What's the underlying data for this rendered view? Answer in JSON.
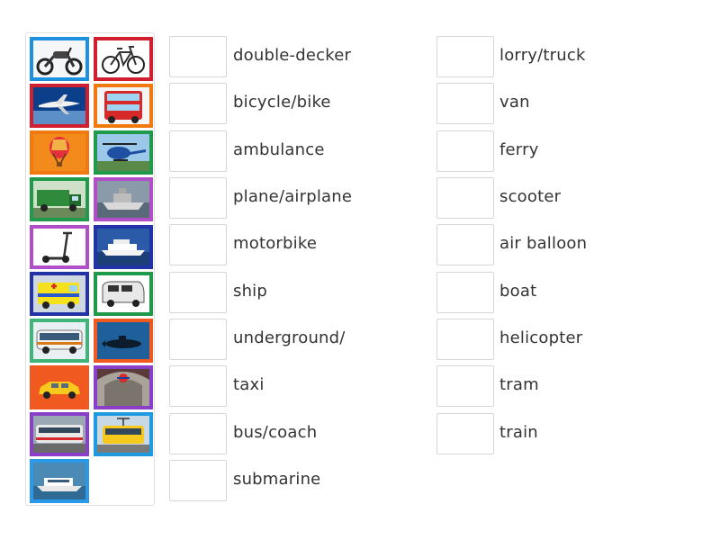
{
  "tiles": [
    {
      "name": "motorbike-picture",
      "border": "#1e90e0",
      "icon": "motorbike"
    },
    {
      "name": "bicycle-picture",
      "border": "#d11f2f",
      "icon": "bicycle"
    },
    {
      "name": "plane-picture",
      "border": "#d11f2f",
      "icon": "plane"
    },
    {
      "name": "double-decker-picture",
      "border": "#f07a10",
      "icon": "double-decker"
    },
    {
      "name": "air-balloon-picture",
      "border": "#f07a10",
      "icon": "air-balloon"
    },
    {
      "name": "helicopter-picture",
      "border": "#1f9a4a",
      "icon": "helicopter"
    },
    {
      "name": "lorry-picture",
      "border": "#1f9a4a",
      "icon": "lorry"
    },
    {
      "name": "boat-picture",
      "border": "#b04fc8",
      "icon": "boat"
    },
    {
      "name": "scooter-picture",
      "border": "#b04fc8",
      "icon": "scooter"
    },
    {
      "name": "ship-picture",
      "border": "#2233a8",
      "icon": "ship"
    },
    {
      "name": "ambulance-picture",
      "border": "#2233a8",
      "icon": "ambulance"
    },
    {
      "name": "van-picture",
      "border": "#1f9a4a",
      "icon": "van"
    },
    {
      "name": "coach-picture",
      "border": "#3fb57a",
      "icon": "coach"
    },
    {
      "name": "submarine-picture",
      "border": "#f05a20",
      "icon": "submarine"
    },
    {
      "name": "taxi-picture",
      "border": "#f05a20",
      "icon": "taxi"
    },
    {
      "name": "underground-picture",
      "border": "#8a3fc8",
      "icon": "underground"
    },
    {
      "name": "train-picture",
      "border": "#8a3fc8",
      "icon": "train"
    },
    {
      "name": "tram-picture",
      "border": "#1e9ae0",
      "icon": "tram"
    },
    {
      "name": "ferry-picture",
      "border": "#2a9ae8",
      "icon": "ferry"
    }
  ],
  "labels_left": [
    "double-decker",
    "bicycle/bike",
    "ambulance",
    "plane/airplane",
    "motorbike",
    "ship",
    "underground/",
    "taxi",
    "bus/coach",
    "submarine"
  ],
  "labels_right": [
    "lorry/truck",
    "van",
    "ferry",
    "scooter",
    "air balloon",
    "boat",
    "helicopter",
    "tram",
    "train"
  ]
}
